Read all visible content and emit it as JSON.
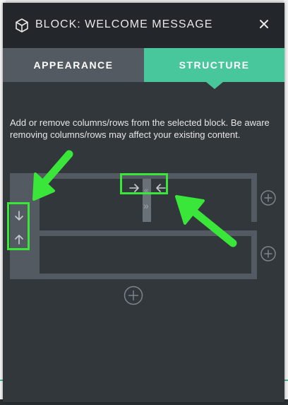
{
  "header": {
    "title": "BLOCK: WELCOME MESSAGE",
    "block_icon": "cube-icon",
    "close_icon": "close-icon"
  },
  "tabs": [
    {
      "label": "APPEARANCE",
      "active": false
    },
    {
      "label": "STRUCTURE",
      "active": true
    }
  ],
  "description": "Add or remove columns/rows from the selected block. Be aware removing columns/rows may affect your existing content.",
  "structure": {
    "rows": [
      {
        "columns": 2,
        "add_column_icon": "plus-circle-icon"
      },
      {
        "columns": 1,
        "add_column_icon": "plus-circle-icon"
      }
    ],
    "add_row_icon": "plus-circle-icon",
    "move_row_down_icon": "arrow-down-icon",
    "move_row_up_icon": "arrow-up-icon",
    "move_column_right_icon": "arrow-right-icon",
    "move_column_left_icon": "arrow-left-icon",
    "column_resize_glyph_top": "«",
    "column_resize_glyph_bottom": "»"
  },
  "colors": {
    "panel_bg": "#32373c",
    "header_bg": "#23272b",
    "accent": "#49c79c",
    "highlight": "#39e639"
  }
}
